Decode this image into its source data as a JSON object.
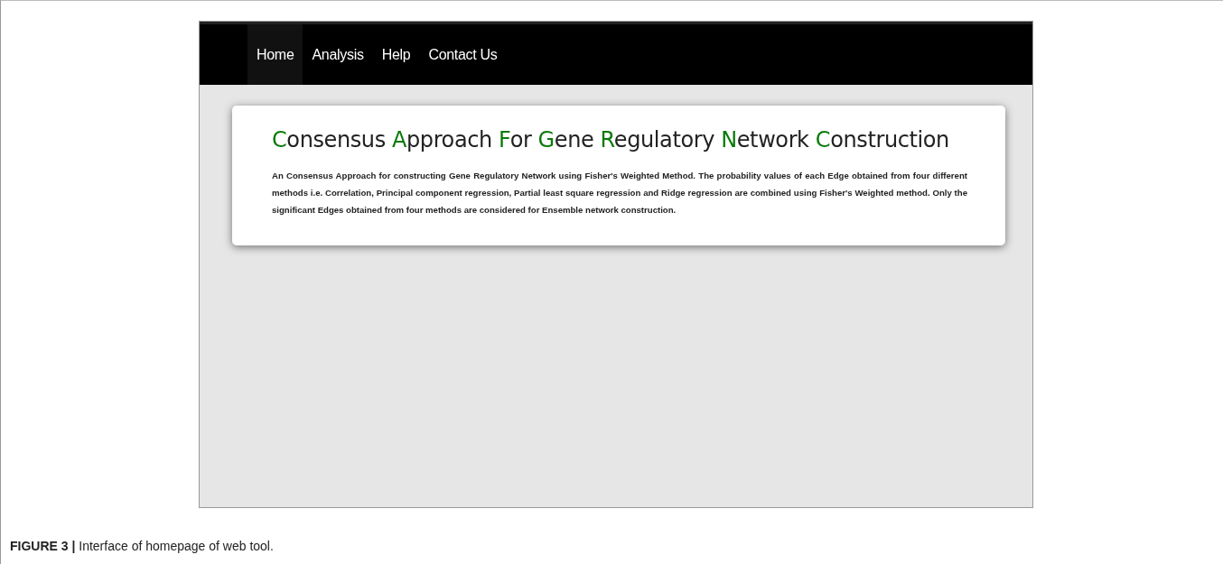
{
  "nav": {
    "items": [
      {
        "label": "Home",
        "selected": true
      },
      {
        "label": "Analysis",
        "selected": false
      },
      {
        "label": "Help",
        "selected": false
      },
      {
        "label": "Contact Us",
        "selected": false
      }
    ]
  },
  "card": {
    "title": "Consensus Approach For Gene Regulatory Network Construction",
    "description": "An Consensus Approach for constructing Gene Regulatory Network using Fisher's Weighted Method. The probability values of each Edge obtained from four different methods i.e. Correlation, Principal component regression, Partial least square regression and Ridge regression are combined using Fisher's Weighted method. Only the significant Edges obtained from four methods are considered for Ensemble network construction."
  },
  "caption": "**FIGURE 3 |** Interface of homepage of web tool."
}
